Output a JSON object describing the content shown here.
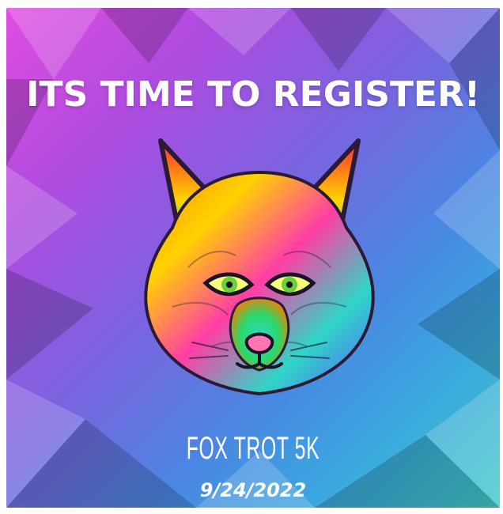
{
  "poster": {
    "headline": "ITS TIME TO REGISTER!",
    "event_name": "FOX TROT 5K",
    "event_date": "9/24/2022",
    "illustration": "rainbow-fox-head-icon",
    "colors": {
      "magenta": "#e04de0",
      "violet": "#7b63df",
      "blue": "#4b86e3",
      "teal": "#42c9c9",
      "text": "#ffffff"
    }
  }
}
